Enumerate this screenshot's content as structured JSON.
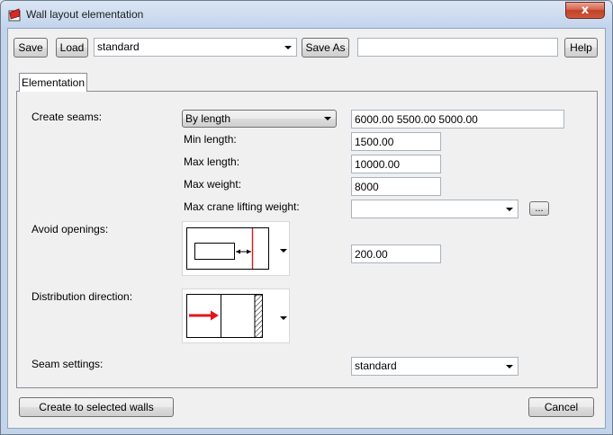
{
  "window": {
    "title": "Wall layout elementation",
    "close_glyph": "x"
  },
  "toolbar": {
    "save_label": "Save",
    "load_label": "Load",
    "preset_value": "standard",
    "save_as_label": "Save As",
    "save_as_value": "",
    "help_label": "Help"
  },
  "tabs": [
    {
      "label": "Elementation",
      "selected": true
    }
  ],
  "form": {
    "create_seams": {
      "label": "Create seams:",
      "mode_value": "By length",
      "lengths_value": "6000.00 5500.00 5000.00"
    },
    "min_length": {
      "label": "Min length:",
      "value": "1500.00"
    },
    "max_length": {
      "label": "Max length:",
      "value": "10000.00"
    },
    "max_weight": {
      "label": "Max weight:",
      "value": "8000"
    },
    "max_crane": {
      "label": "Max crane lifting weight:",
      "value": "",
      "browse_label": "..."
    },
    "avoid_openings": {
      "label": "Avoid openings:",
      "distance_value": "200.00",
      "icon": "opening-distance-icon"
    },
    "distribution_direction": {
      "label": "Distribution direction:",
      "icon": "direction-arrow-icon"
    },
    "seam_settings": {
      "label": "Seam settings:",
      "value": "standard"
    }
  },
  "footer": {
    "create_label": "Create to selected walls",
    "cancel_label": "Cancel"
  },
  "colors": {
    "accent_red": "#e0161c",
    "title_bar": "#c2d4ec",
    "client_bg": "#f0f0f0"
  }
}
